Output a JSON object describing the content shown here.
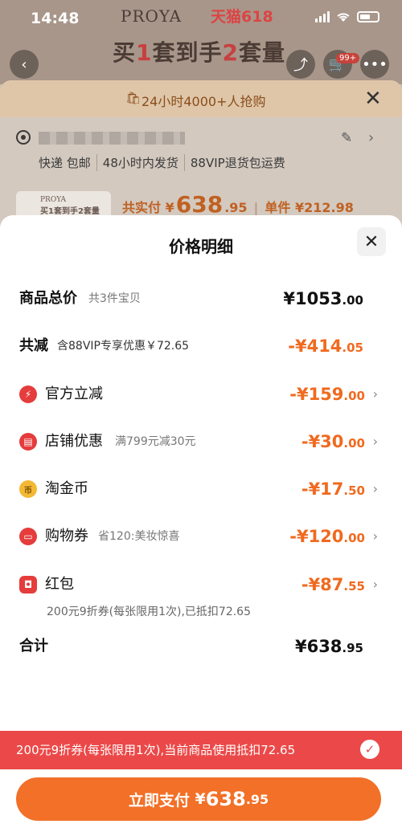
{
  "status_bar": {
    "time": "14:48"
  },
  "background": {
    "brand": "PROYA",
    "tmall": "天猫618",
    "slogan_parts": [
      "买",
      "1",
      "套到手",
      "2",
      "套量"
    ],
    "cart_badge": "99+",
    "promo": "24小时4000+人抢购",
    "shipping": [
      "快递 包邮",
      "48小时内发货",
      "88VIP退货包运费"
    ],
    "thumb_brand": "PROYA",
    "thumb_slogan": "买1套到手2套量",
    "pay_label": "共实付",
    "pay_currency": "¥",
    "pay_int": "638",
    "pay_dec": ".95",
    "unit_label": "单件",
    "unit_price": "¥212.98"
  },
  "modal": {
    "title": "价格明细",
    "total": {
      "label": "商品总价",
      "sub": "共3件宝贝",
      "int": "¥1053",
      "dec": ".00"
    },
    "reduction": {
      "label": "共减",
      "sub": "含88VIP专享优惠￥72.65",
      "int": "-¥414",
      "dec": ".05"
    },
    "items": [
      {
        "label": "官方立减",
        "sub": "",
        "int": "-¥159",
        "dec": ".00",
        "icon": "lightning-icon"
      },
      {
        "label": "店铺优惠",
        "sub": "满799元减30元",
        "int": "-¥30",
        "dec": ".00",
        "icon": "shop-icon"
      },
      {
        "label": "淘金币",
        "sub": "",
        "int": "-¥17",
        "dec": ".50",
        "icon": "coin-icon"
      },
      {
        "label": "购物券",
        "sub": "省120:美妆惊喜",
        "int": "-¥120",
        "dec": ".00",
        "icon": "ticket-icon"
      },
      {
        "label": "红包",
        "sub": "",
        "int": "-¥87",
        "dec": ".55",
        "icon": "red-packet-icon"
      }
    ],
    "hongbao_note": "200元9折券(每张限用1次),已抵扣72.65",
    "sum": {
      "label": "合计",
      "int": "¥638",
      "dec": ".95"
    }
  },
  "coupon_bar": {
    "text": "200元9折券(每张限用1次),当前商品使用抵扣72.65"
  },
  "pay_button": {
    "label": "立即支付",
    "currency": "¥",
    "int": "638",
    "dec": ".95"
  }
}
